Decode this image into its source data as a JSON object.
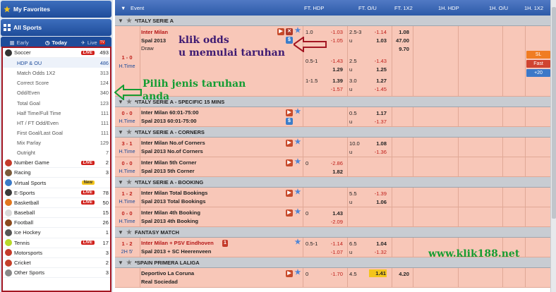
{
  "sidebar": {
    "favorites_label": "My Favorites",
    "all_sports_label": "All Sports",
    "tabs": [
      {
        "label": "Early",
        "icon": "calendar-icon"
      },
      {
        "label": "Today",
        "icon": "clock-icon"
      },
      {
        "label": "Live",
        "icon": "live-icon",
        "badge": "TV"
      }
    ],
    "live_badge": "LIVE",
    "new_badge": "New",
    "sports": [
      {
        "name": "Soccer",
        "count": "493",
        "live": true,
        "icon_color": "#333333"
      },
      {
        "name": "HDP & OU",
        "count": "486",
        "sub": true,
        "active": true
      },
      {
        "name": "Match Odds 1X2",
        "count": "313",
        "sub": true
      },
      {
        "name": "Correct Score",
        "count": "124",
        "sub": true
      },
      {
        "name": "Odd/Even",
        "count": "340",
        "sub": true
      },
      {
        "name": "Total Goal",
        "count": "123",
        "sub": true
      },
      {
        "name": "Half Time/Full Time",
        "count": "111",
        "sub": true
      },
      {
        "name": "HT / FT Odd/Even",
        "count": "111",
        "sub": true
      },
      {
        "name": "First Goal/Last Goal",
        "count": "111",
        "sub": true
      },
      {
        "name": "Mix Parlay",
        "count": "129",
        "sub": true
      },
      {
        "name": "Outright",
        "count": "7",
        "sub": true
      },
      {
        "name": "Number Game",
        "count": "2",
        "live": true,
        "icon_color": "#c43a2a"
      },
      {
        "name": "Racing",
        "count": "3",
        "icon_color": "#7a5a3a"
      },
      {
        "name": "Virtual Sports",
        "count": "",
        "new": true,
        "icon_color": "#3a7ac8"
      },
      {
        "name": "E-Sports",
        "count": "78",
        "live": true,
        "icon_color": "#3a3a3a"
      },
      {
        "name": "Basketball",
        "count": "50",
        "live": true,
        "icon_color": "#e2771e"
      },
      {
        "name": "Baseball",
        "count": "15",
        "icon_color": "#d8d8d8"
      },
      {
        "name": "Football",
        "count": "26",
        "icon_color": "#8a4a1e"
      },
      {
        "name": "Ice Hockey",
        "count": "1",
        "icon_color": "#555555"
      },
      {
        "name": "Tennis",
        "count": "17",
        "live": true,
        "icon_color": "#b8d82a"
      },
      {
        "name": "Motorsports",
        "count": "3",
        "icon_color": "#c43a2a"
      },
      {
        "name": "Cricket",
        "count": "2",
        "icon_color": "#c4402a"
      },
      {
        "name": "Other Sports",
        "count": "3",
        "icon_color": "#888888"
      }
    ]
  },
  "table": {
    "headers": {
      "event": "Event",
      "ft_hdp": "FT. HDP",
      "ft_ou": "FT. O/U",
      "ft_1x2": "FT. 1X2",
      "h1_hdp": "1H. HDP",
      "h1_ou": "1H. O/U",
      "h1_1x2": "1H. 1X2"
    }
  },
  "leagues": {
    "l1": "*ITALY SERIE A",
    "l2": "*ITALY SERIE A - SPECIFIC 15 MINS",
    "l3": "*ITALY SERIE A - CORNERS",
    "l4": "*ITALY SERIE A - BOOKING",
    "l5": "FANTASY MATCH",
    "l6": "*SPAIN PRIMERA LALIGA"
  },
  "matches": {
    "m1": {
      "score": "1 - 0",
      "time": "H.Time",
      "home": "Inter Milan",
      "away": "Spal 2013",
      "draw": "Draw",
      "r1": {
        "hdp": "1.0",
        "h": "-1.03",
        "ou": "2.5-3",
        "o": "-1.14",
        "x1": "1.08"
      },
      "r1b": {
        "a": "-1.05",
        "u_label": "u",
        "u": "1.03",
        "x2": "47.00"
      },
      "r1c": {
        "xd": "9.70"
      },
      "r2": {
        "hdp": "0.5-1",
        "h": "-1.43",
        "ou": "2.5",
        "o": "-1.43"
      },
      "r2b": {
        "a": "1.29",
        "u_label": "u",
        "u": "1.25"
      },
      "r3": {
        "hdp": "1-1.5",
        "h": "1.39",
        "ou": "3.0",
        "o": "1.27"
      },
      "r3b": {
        "a": "-1.57",
        "u_label": "u",
        "u": "-1.45"
      }
    },
    "m2": {
      "score": "0 - 0",
      "time": "H.Time",
      "home": "Inter Milan 60:01-75:00",
      "away": "Spal 2013 60:01-75:00",
      "ou": "0.5",
      "o": "1.17",
      "u_label": "u",
      "u": "-1.37"
    },
    "m3": {
      "score": "3 - 1",
      "time": "H.Time",
      "home": "Inter Milan No.of Corners",
      "away": "Spal 2013 No.of Corners",
      "ou": "10.0",
      "o": "1.08",
      "u_label": "u",
      "u": "-1.36"
    },
    "m4": {
      "score": "0 - 0",
      "time": "H.Time",
      "home": "Inter Milan 5th Corner",
      "away": "Spal 2013 5th Corner",
      "hdp": "0",
      "h": "-2.86",
      "a": "1.82"
    },
    "m5": {
      "score": "1 - 2",
      "time": "H.Time",
      "home": "Inter Milan Total Bookings",
      "away": "Spal 2013 Total Bookings",
      "ou": "5.5",
      "o": "-1.39",
      "u_label": "u",
      "u": "1.06"
    },
    "m6": {
      "score": "0 - 0",
      "time": "H.Time",
      "home": "Inter Milan 4th Booking",
      "away": "Spal 2013 4th Booking",
      "hdp": "0",
      "h": "1.43",
      "a": "-2.09"
    },
    "m7": {
      "score": "1 - 2",
      "time": "2H 5'",
      "home": "Inter Milan + PSV Eindhoven",
      "red_card": "1",
      "away": "Spal 2013 + SC Heerenveen",
      "hdp": "0.5-1",
      "h": "-1.14",
      "ou": "6.5",
      "o": "1.04",
      "a": "-1.07",
      "u_label": "u",
      "u": "-1.32"
    },
    "m8": {
      "home": "Deportivo La Coruna",
      "away": "Real Sociedad",
      "hdp": "0",
      "h": "-1.70",
      "ou": "4.5",
      "o": "1.41",
      "x1": "4.20"
    }
  },
  "right_panel": {
    "sl": "SL",
    "fast": "Fast",
    "more": "+20"
  },
  "annotations": {
    "odds_line1": "klik odds",
    "odds_line2": "u memulai taruhan",
    "bet_line1": "Pilih jenis taruhan",
    "bet_line2": "anda",
    "site": "www.klik188.net"
  },
  "colors": {
    "header_blue": "#2c5aa8",
    "live_row": "#f8c7b8",
    "highlight_box": "#a31622",
    "annotation_green": "#159d33",
    "annotation_purple": "#3d1a72"
  }
}
